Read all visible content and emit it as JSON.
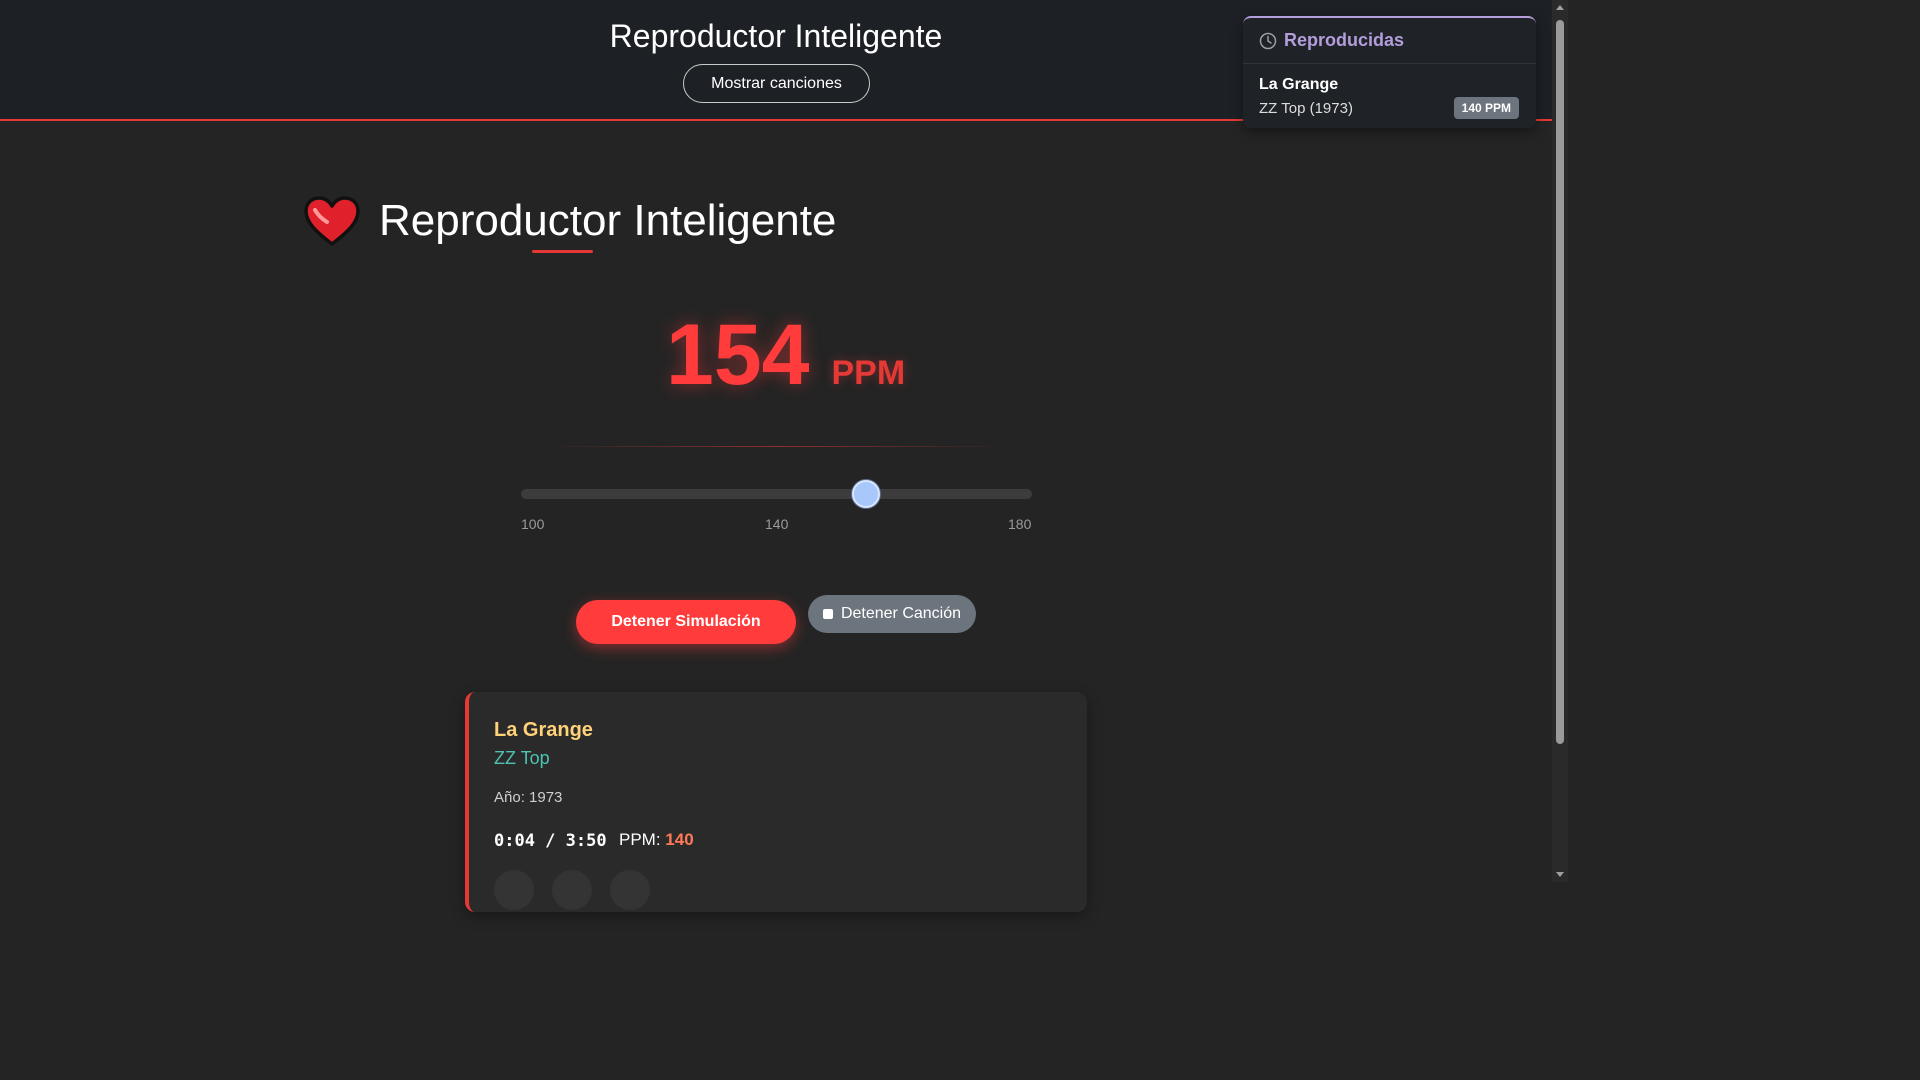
{
  "header": {
    "title": "Reproductor Inteligente",
    "show_songs_label": "Mostrar canciones"
  },
  "history": {
    "title": "Reproducidas",
    "icon": "clock-icon",
    "items": [
      {
        "title": "La Grange",
        "artist_year": "ZZ Top (1973)",
        "bpm_badge": "140 PPM"
      }
    ]
  },
  "main": {
    "title": "Reproductor Inteligente",
    "icon": "heart-icon",
    "bpm_value": "154",
    "bpm_unit": "PPM",
    "slider": {
      "min": 100,
      "max": 180,
      "value": 154,
      "ticks": [
        "100",
        "140",
        "180"
      ]
    }
  },
  "buttons": {
    "stop_simulation": "Detener Simulación",
    "stop_song": "Detener Canción"
  },
  "now_playing": {
    "title": "La Grange",
    "artist": "ZZ Top",
    "year_text": "Año: 1973",
    "time": "0:04 / 3:50",
    "bpm_label": "PPM:",
    "bpm_value": "140"
  },
  "colors": {
    "accent_red": "#ff3b3b",
    "history_accent": "#b39ddb",
    "song_title": "#ffd27a",
    "song_artist": "#4fc3b3",
    "slider_thumb": "#a8c7fa"
  }
}
